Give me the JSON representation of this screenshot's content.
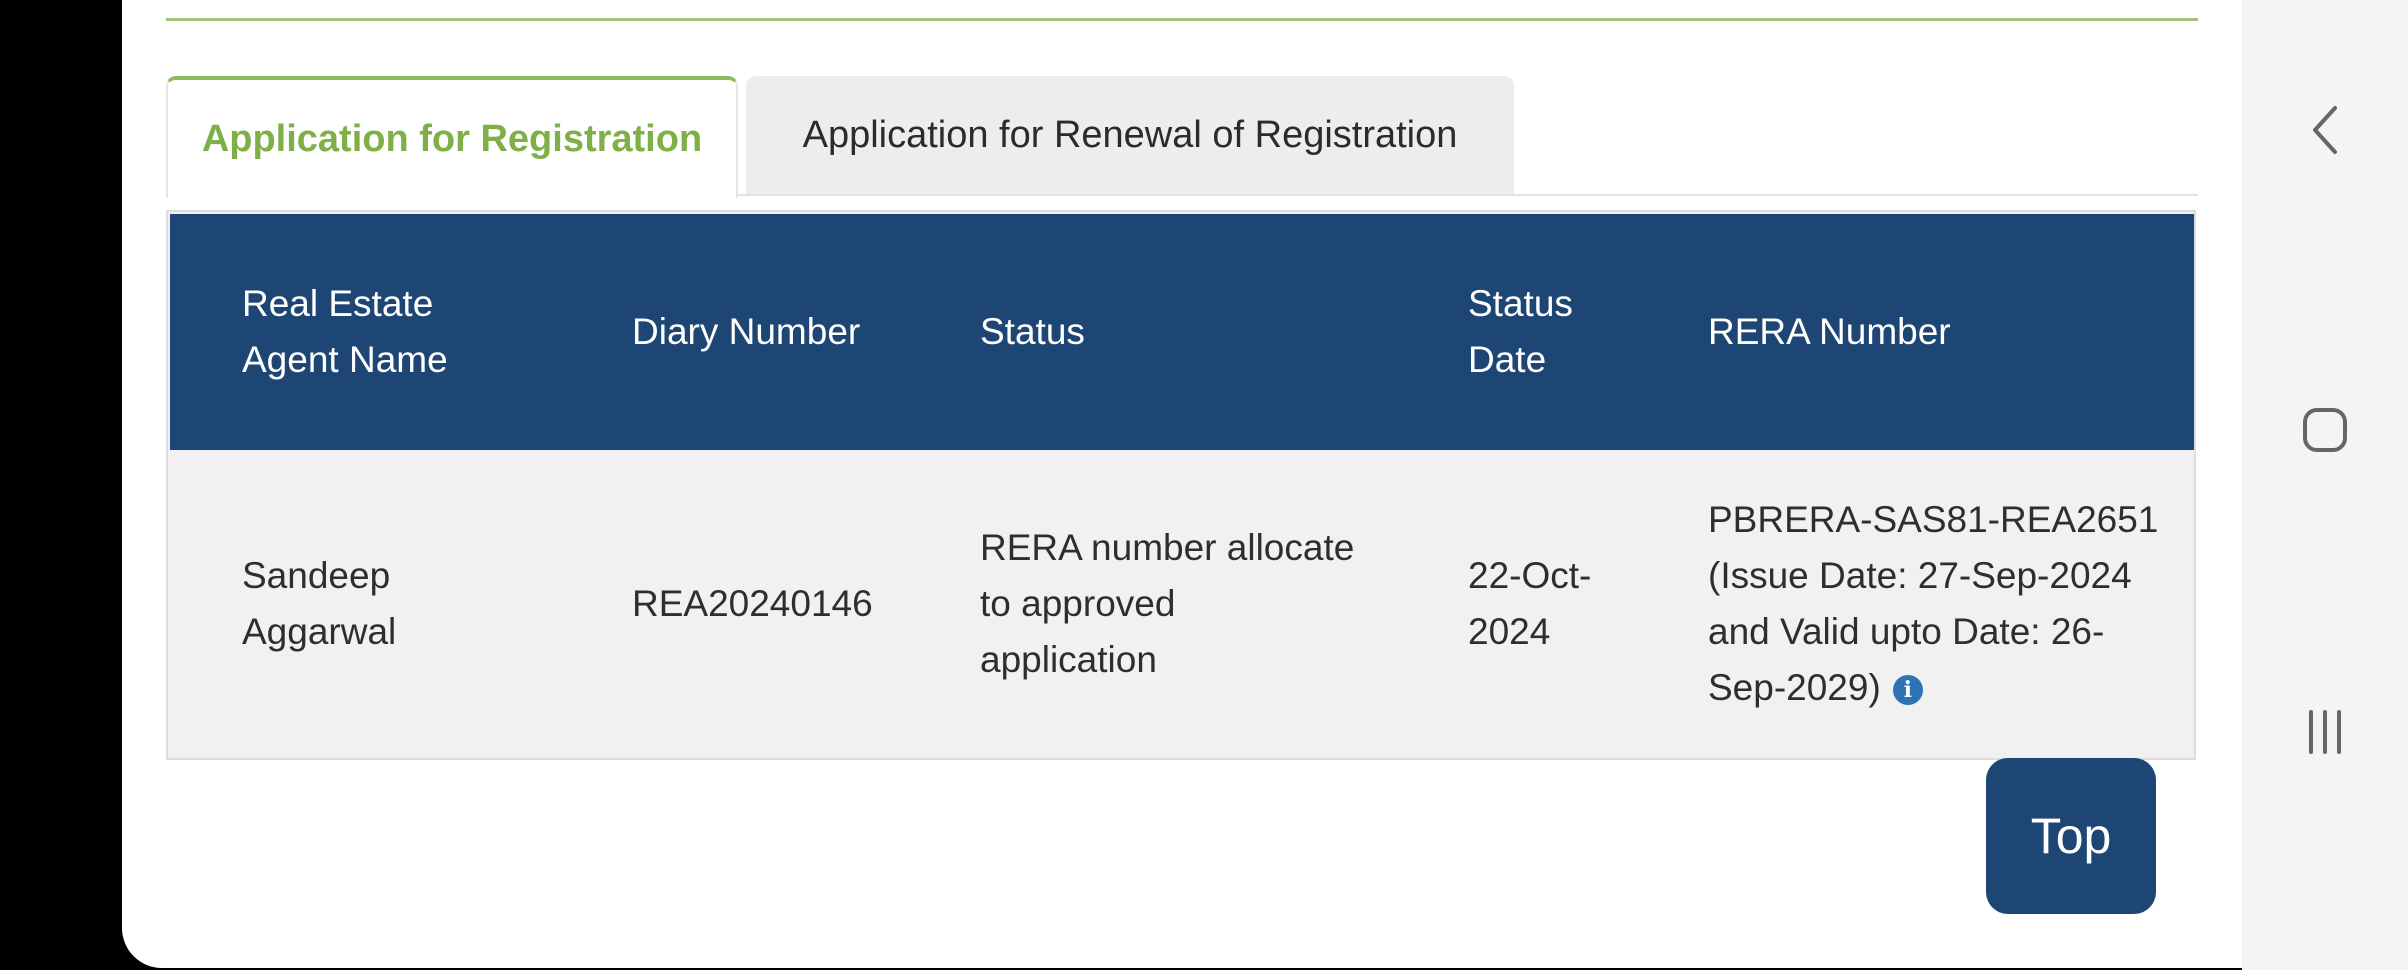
{
  "tabs": [
    {
      "label": "Application for Registration",
      "active": true
    },
    {
      "label": "Application for Renewal of Registration",
      "active": false
    }
  ],
  "table": {
    "headers": {
      "agent_name": [
        "Real Estate",
        "Agent Name"
      ],
      "diary_number": "Diary Number",
      "status": "Status",
      "status_date": [
        "Status",
        "Date"
      ],
      "rera_number": "RERA Number"
    },
    "rows": [
      {
        "agent_name": [
          "Sandeep",
          "Aggarwal"
        ],
        "diary_number": "REA20240146",
        "status": [
          "RERA number allocate",
          "to approved",
          "application"
        ],
        "status_date": [
          "22-Oct-",
          "2024"
        ],
        "rera_number": [
          "PBRERA-SAS81-REA2651",
          "(Issue Date: 27-Sep-2024",
          "and Valid upto Date: 26-",
          "Sep-2029)"
        ]
      }
    ]
  },
  "top_button": {
    "label": "Top"
  },
  "icons": {
    "info": "info-icon",
    "back": "back-chevron-icon",
    "home": "home-square-icon",
    "recents": "recents-bars-icon"
  },
  "colors": {
    "accent_green": "#8dbb5d",
    "header_navy": "#1e4675",
    "info_blue": "#2f73b7"
  }
}
